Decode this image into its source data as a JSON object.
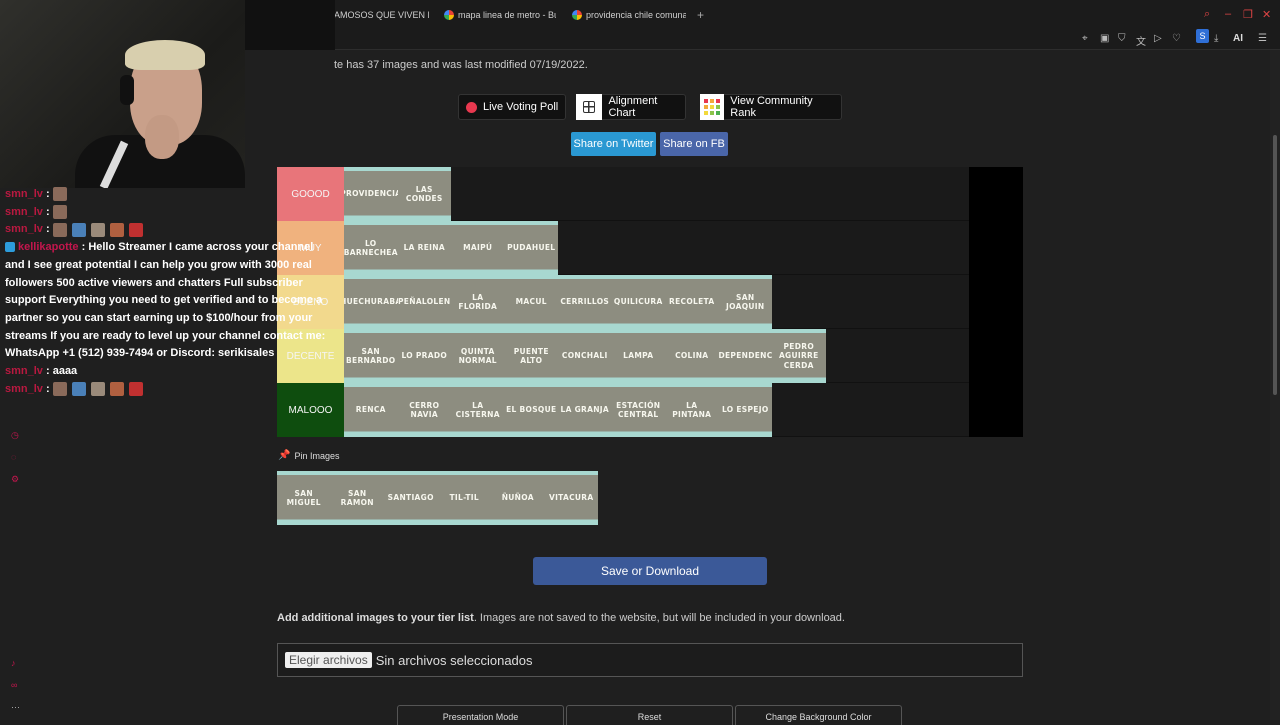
{
  "browser": {
    "tabs": [
      {
        "label": "AMOSOS QUE VIVEN EN"
      },
      {
        "label": "mapa linea de metro - Bus"
      },
      {
        "label": "providencia chile comuna"
      }
    ],
    "new_tab": "+",
    "profile_initial": "S",
    "ai_label": "AI"
  },
  "page": {
    "summary": "te has 37 images and was last modified 07/19/2022.",
    "buttons": {
      "live_poll": "Live Voting Poll",
      "alignment_chart": "Alignment Chart",
      "community_rank": "View Community Rank",
      "share_twitter": "Share on Twitter",
      "share_fb": "Share on FB",
      "save": "Save or Download",
      "presentation": "Presentation Mode",
      "reset": "Reset",
      "change_bg": "Change Background Color"
    },
    "colors": {
      "twitter": "#2a98d2",
      "facebook": "#4a66a9",
      "save": "#3b5998"
    },
    "tiers": [
      {
        "label": "GOOOD",
        "color": "#e8757a",
        "items": [
          "PROVIDENCIA",
          "LAS CONDES"
        ]
      },
      {
        "label": "MUY",
        "color": "#f0b27e",
        "items": [
          "LO BARNECHEA",
          "LA REINA",
          "MAIPÚ",
          "PUDAHUEL"
        ]
      },
      {
        "label": "BUENO",
        "color": "#f2d98d",
        "items": [
          "HUECHURABA",
          "PEÑALOLEN",
          "LA FLORIDA",
          "MACUL",
          "CERRILLOS",
          "QUILICURA",
          "RECOLETA",
          "SAN JOAQUIN"
        ]
      },
      {
        "label": "DECENTE",
        "color": "#ece58a",
        "items": [
          "SAN BERNARDO",
          "LO PRADO",
          "QUINTA NORMAL",
          "PUENTE ALTO",
          "CONCHALI",
          "LAMPA",
          "COLINA",
          "INDEPENDENCIA",
          "PEDRO AGUIRRE CERDA"
        ]
      },
      {
        "label": "MALOOO",
        "color": "#0e4d0e",
        "items": [
          "RENCA",
          "CERRO NAVIA",
          "LA CISTERNA",
          "EL BOSQUE",
          "LA GRANJA",
          "ESTACIÓN CENTRAL",
          "LA PINTANA",
          "LO ESPEJO"
        ]
      }
    ],
    "pin_label": "Pin Images",
    "pinned": [
      "SAN MIGUEL",
      "SAN RAMON",
      "SANTIAGO",
      "TIL-TIL",
      "ÑUÑOA",
      "VITACURA"
    ],
    "add_info_bold": "Add additional images to your tier list",
    "add_info_rest": ". Images are not saved to the website, but will be included in your download.",
    "file_button": "Elegir archivos",
    "file_status": "Sin archivos seleccionados"
  },
  "chat": [
    {
      "user": "smn_lv",
      "text": "",
      "emotes": 1
    },
    {
      "user": "smn_lv",
      "text": "",
      "emotes": 1
    },
    {
      "user": "smn_lv",
      "text": "",
      "emotes": 5
    },
    {
      "user": "kellikapotte",
      "text": "Hello Streamer I came across your channel and I see great potential I can help you grow with 3000 real followers 500 active viewers and chatters Full subscriber support Everything you need to get verified and to become a partner so you can start earning up to $100/hour from your streams If you are ready to level up your channel contact me: WhatsApp +1 (512) 939-7494 or Discord: serikisales"
    },
    {
      "user": "smn_lv",
      "text": "aaaa"
    },
    {
      "user": "smn_lv",
      "text": "",
      "emotes": 5
    }
  ]
}
